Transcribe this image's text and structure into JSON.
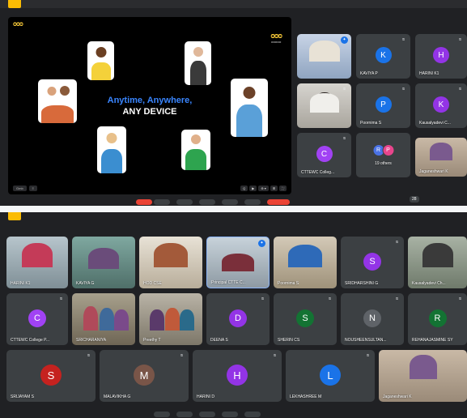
{
  "screenshot1": {
    "presentation": {
      "logo": "ᴑᴑᴑ",
      "logo_right": "ᴑᴑᴑ",
      "logo_right_sub": "ᴑᴑᴑᴑᴑ",
      "tagline1": "Anytime, Anywhere,",
      "tagline2": "ANY DEVICE",
      "controls_left": [
        "Gmb",
        "≡"
      ],
      "controls_right": [
        "Q",
        "▶",
        "⊕ ▾",
        "⊞",
        "⛶"
      ]
    },
    "tiles": [
      {
        "name": "",
        "type": "video",
        "pinned": true
      },
      {
        "name": "KAVIYA P",
        "type": "avatar",
        "initial": "K",
        "color": "#1a73e8"
      },
      {
        "name": "HARINI K1",
        "type": "avatar",
        "initial": "H",
        "color": "#9334e6"
      },
      {
        "name": "",
        "type": "video"
      },
      {
        "name": "Poornima S",
        "type": "avatar",
        "initial": "P",
        "color": "#1a73e8"
      },
      {
        "name": "Kausalyadevi C...",
        "type": "avatar",
        "initial": "K",
        "color": "#9334e6"
      },
      {
        "name": "CTTEWC Colleg...",
        "type": "avatar",
        "initial": "C",
        "color": "#a142f4"
      },
      {
        "name": "19 others",
        "type": "others",
        "initials": [
          "R",
          "P"
        ],
        "colors": [
          "#4a72e5",
          "#e8458c"
        ]
      },
      {
        "name": "Jaganeshwari K",
        "type": "video"
      }
    ],
    "count_badge": "28"
  },
  "screenshot2": {
    "tiles_row1": [
      {
        "name": "HARINI K1",
        "type": "video"
      },
      {
        "name": "KAVIYA G",
        "type": "video"
      },
      {
        "name": "HOD CSE",
        "type": "video"
      },
      {
        "name": "Principal CTTE C...",
        "type": "video",
        "pinned": true
      },
      {
        "name": "Poornima S",
        "type": "video"
      },
      {
        "name": "SRIDHARSHINI G",
        "type": "avatar",
        "initial": "S",
        "color": "#9334e6"
      },
      {
        "name": "Kausalyadevi Ch...",
        "type": "video"
      }
    ],
    "tiles_row2": [
      {
        "name": "CTTEWC College P...",
        "type": "avatar",
        "initial": "C",
        "color": "#a142f4"
      },
      {
        "name": "SRICHARANIYA",
        "type": "video"
      },
      {
        "name": "Preethy T",
        "type": "video"
      },
      {
        "name": "DEENA S",
        "type": "avatar",
        "initial": "D",
        "color": "#9334e6"
      },
      {
        "name": "SHERIN CS",
        "type": "avatar",
        "initial": "S",
        "color": "#137333"
      },
      {
        "name": "NOUSHEENSULTAN...",
        "type": "avatar",
        "initial": "N",
        "color": "#5f6368"
      },
      {
        "name": "REHANAJASMINE SY",
        "type": "avatar",
        "initial": "R",
        "color": "#137333"
      }
    ],
    "tiles_row3": [
      {
        "name": "SRIJAYAM S",
        "type": "avatar",
        "initial": "S",
        "color": "#c5221f"
      },
      {
        "name": "MALAVIKHA G",
        "type": "avatar",
        "initial": "M",
        "color": "#795548"
      },
      {
        "name": "HARINI D",
        "type": "avatar",
        "initial": "H",
        "color": "#9334e6"
      },
      {
        "name": "LEKHASHREE M",
        "type": "avatar",
        "initial": "L",
        "color": "#1a73e8"
      },
      {
        "name": "Jaganeshwari K",
        "type": "video"
      }
    ]
  },
  "colors": {
    "meet_bg": "#202124",
    "tile_bg": "#3c4043",
    "accent_blue": "#1a73e8",
    "tag_yellow": "#fbbc04"
  }
}
